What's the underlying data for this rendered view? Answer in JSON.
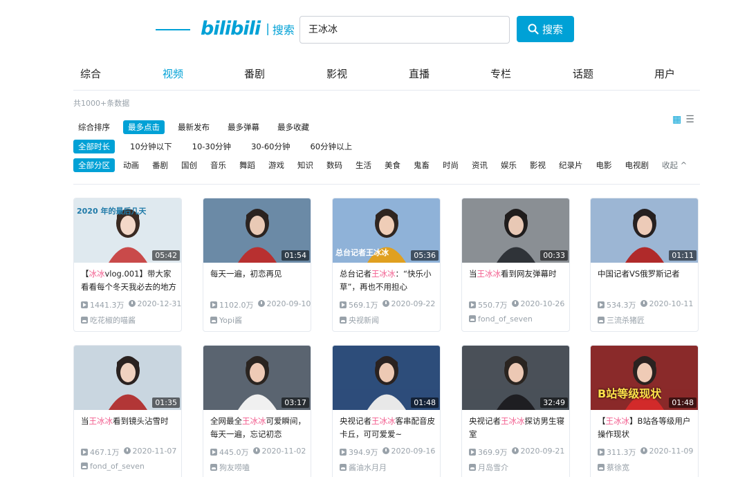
{
  "header": {
    "logo": "bilibili",
    "separator": "|",
    "subtitle": "搜索",
    "query": "王冰冰",
    "search_button": "搜索"
  },
  "tabs": [
    "综合",
    "视频",
    "番剧",
    "影视",
    "直播",
    "专栏",
    "话题",
    "用户"
  ],
  "active_tab": "视频",
  "result_count": "共1000+条数据",
  "sort_options": [
    "综合排序",
    "最多点击",
    "最新发布",
    "最多弹幕",
    "最多收藏"
  ],
  "duration_options": [
    "全部时长",
    "10分钟以下",
    "10-30分钟",
    "30-60分钟",
    "60分钟以上"
  ],
  "zone_options": [
    "全部分区",
    "动画",
    "番剧",
    "国创",
    "音乐",
    "舞蹈",
    "游戏",
    "知识",
    "数码",
    "生活",
    "美食",
    "鬼畜",
    "时尚",
    "资讯",
    "娱乐",
    "影视",
    "纪录片",
    "电影",
    "电视剧"
  ],
  "collapse_label": "收起 ^",
  "videos": [
    {
      "title_parts": [
        "【",
        "冰冰",
        "vlog.001】带大家看看每个冬天我必去的地方"
      ],
      "duration": "05:42",
      "views": "1441.3万",
      "date": "2020-12-31",
      "uploader": "吃花椒的喵酱"
    },
    {
      "title_parts": [
        "每天一遍，初恋再见",
        "",
        ""
      ],
      "duration": "01:54",
      "views": "1102.0万",
      "date": "2020-09-10",
      "uploader": "Yopi酱"
    },
    {
      "title_parts": [
        "总台记者",
        "王冰冰",
        "：“快乐小草”，再也不用担心会“秃”了"
      ],
      "duration": "05:36",
      "views": "569.1万",
      "date": "2020-09-22",
      "uploader": "央视新闻"
    },
    {
      "title_parts": [
        "当",
        "王冰冰",
        "看到网友弹幕时"
      ],
      "duration": "00:33",
      "views": "550.7万",
      "date": "2020-10-26",
      "uploader": "fond_of_seven"
    },
    {
      "title_parts": [
        "中国记者VS俄罗斯记者",
        "",
        ""
      ],
      "duration": "01:11",
      "views": "534.3万",
      "date": "2020-10-11",
      "uploader": "三流杀猪匠"
    },
    {
      "title_parts": [
        "当",
        "王冰冰",
        "看到镜头沾雪时"
      ],
      "duration": "01:35",
      "views": "467.1万",
      "date": "2020-11-07",
      "uploader": "fond_of_seven"
    },
    {
      "title_parts": [
        "全网最全",
        "王冰冰",
        "可爱瞬间，每天一遍，忘记初恋"
      ],
      "duration": "03:17",
      "views": "445.0万",
      "date": "2020-11-02",
      "uploader": "狗友唠嗑"
    },
    {
      "title_parts": [
        "央视记者",
        "王冰冰",
        "客串配音皮卡丘，可可爱爱~"
      ],
      "duration": "01:48",
      "views": "394.9万",
      "date": "2020-09-16",
      "uploader": "酱油水月月"
    },
    {
      "title_parts": [
        "央视记者",
        "王冰冰",
        "探访男生寝室"
      ],
      "duration": "32:49",
      "views": "369.9万",
      "date": "2020-09-21",
      "uploader": "月岛雪介"
    },
    {
      "title_parts": [
        "【",
        "王冰冰",
        "】B站各等级用户操作现状"
      ],
      "duration": "01:48",
      "views": "311.3万",
      "date": "2020-11-09",
      "uploader": "蔡徐宽"
    }
  ],
  "thumb_texts": {
    "v0": "2020 年的最后几天",
    "v2": "总台记者王冰冰",
    "v9": "B站等级现状"
  },
  "colors": {
    "accent": "#00a1d6",
    "highlight": "#f25d8e",
    "meta": "#99a2aa"
  }
}
